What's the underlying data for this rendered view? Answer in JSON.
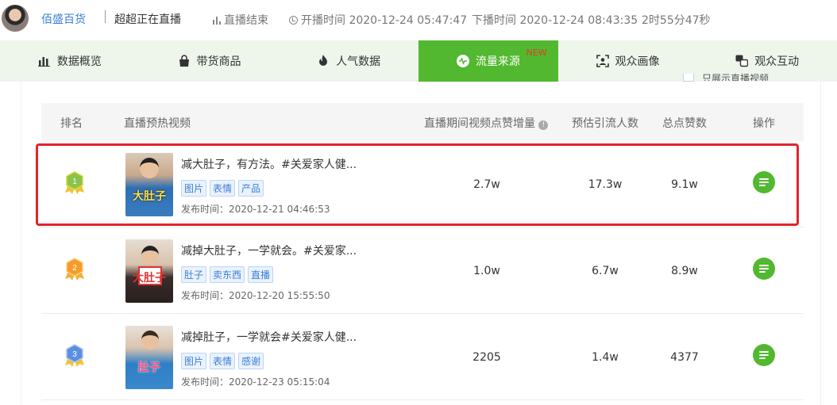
{
  "header": {
    "shop_name": "佰盛百货",
    "live_title": "超超正在直播",
    "status": "直播结束",
    "start_time": "开播时间 2020-12-24 05:47:47",
    "end_time": "下播时间 2020-12-24 08:43:35",
    "duration": "2时55分47秒"
  },
  "tabs": [
    {
      "label": "数据概览",
      "icon": "bar-chart-icon"
    },
    {
      "label": "带货商品",
      "icon": "shopping-bag-icon"
    },
    {
      "label": "人气数据",
      "icon": "fire-icon"
    },
    {
      "label": "流量来源",
      "icon": "wave-icon",
      "active": true,
      "badge": "NEW"
    },
    {
      "label": "观众画像",
      "icon": "person-frame-icon"
    },
    {
      "label": "观众互动",
      "icon": "chat-bubble-icon"
    }
  ],
  "filter_label": "只展示直播视频",
  "table": {
    "headers": {
      "rank": "排名",
      "video": "直播预热视频",
      "likes_increase": "直播期间视频点赞增量",
      "traffic": "预估引流人数",
      "total_likes": "总点赞数",
      "action": "操作"
    },
    "rows": [
      {
        "rank": "1",
        "thumb_text": "大肚子",
        "title": "减大肚子，有方法。#关爱家人健...",
        "tags": [
          "图片",
          "表情",
          "产品"
        ],
        "published": "发布时间：2020-12-21 04:46:53",
        "likes_increase": "2.7w",
        "traffic": "17.3w",
        "total_likes": "9.1w"
      },
      {
        "rank": "2",
        "thumb_text": "大肚子",
        "title": "减掉大肚子，一学就会。#关爱家...",
        "tags": [
          "肚子",
          "卖东西",
          "直播"
        ],
        "published": "发布时间：2020-12-20 15:55:50",
        "likes_increase": "1.0w",
        "traffic": "6.7w",
        "total_likes": "8.9w"
      },
      {
        "rank": "3",
        "thumb_text": "肚子",
        "title": "减掉肚子，一学就会#关爱家人健...",
        "tags": [
          "图片",
          "表情",
          "感谢"
        ],
        "published": "发布时间：2020-12-23 05:15:04",
        "likes_increase": "2205",
        "traffic": "1.4w",
        "total_likes": "4377"
      }
    ]
  },
  "colors": {
    "accent": "#52b82f",
    "tab_bar": "#eef6ec",
    "link": "#3a7fd5",
    "highlight": "#e3242b",
    "new_badge": "#e23b2e"
  }
}
